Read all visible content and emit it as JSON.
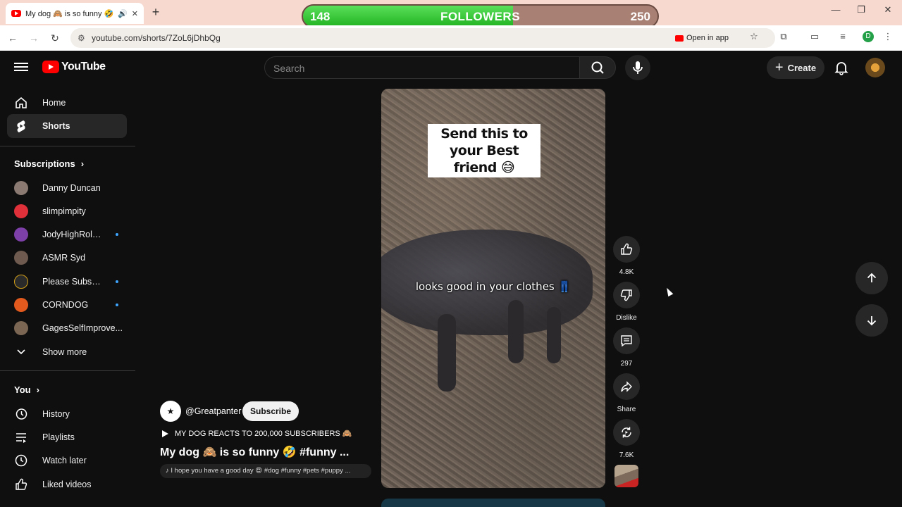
{
  "browser": {
    "tab_title": "My dog 🙈 is so funny 🤣 #funny",
    "url": "youtube.com/shorts/7ZoL6jDhbQg",
    "open_in_app": "Open in app",
    "profile_initial": "D"
  },
  "followers": {
    "current": "148",
    "label": "FOLLOWERS",
    "goal": "250",
    "progress": 0.592
  },
  "header": {
    "logo_text": "YouTube",
    "search_placeholder": "Search",
    "create_label": "Create"
  },
  "sidebar": {
    "nav": [
      {
        "label": "Home",
        "icon": "home-icon"
      },
      {
        "label": "Shorts",
        "icon": "shorts-icon",
        "active": true
      }
    ],
    "subscriptions_label": "Subscriptions",
    "subscriptions": [
      {
        "name": "Danny Duncan",
        "color": "#8a7a72",
        "new": false
      },
      {
        "name": "slimpimpity",
        "color": "#e0303a",
        "new": false
      },
      {
        "name": "JodyHighRoller",
        "color": "#7d3fa8",
        "new": true
      },
      {
        "name": "ASMR Syd",
        "color": "#6e5a4f",
        "new": false
      },
      {
        "name": "Please Subscrib...",
        "color": "#2a2a2a",
        "new": true
      },
      {
        "name": "CORNDOG",
        "color": "#e35a1e",
        "new": true
      },
      {
        "name": "GagesSelfImprove...",
        "color": "#7a6652",
        "new": false
      }
    ],
    "show_more": "Show more",
    "you_label": "You",
    "you_items": [
      {
        "label": "History",
        "icon": "history-icon"
      },
      {
        "label": "Playlists",
        "icon": "playlists-icon"
      },
      {
        "label": "Watch later",
        "icon": "watch-later-icon"
      },
      {
        "label": "Liked videos",
        "icon": "like-icon"
      }
    ]
  },
  "short": {
    "caption_top": "Send this to your Best friend 😅",
    "caption_mid": "looks good in your clothes 👖",
    "channel": "@Greatpanter",
    "channel_avatar_glyph": "★",
    "subscribe_label": "Subscribe",
    "playlist_title": "MY DOG REACTS TO 200,000 SUBSCRIBERS 🙈",
    "title": "My dog 🙈 is so funny 🤣 #funny ...",
    "description": "I hope you have a good day 😍 #dog #funny #pets #puppy ..."
  },
  "actions": {
    "likes": "4.8K",
    "dislike": "Dislike",
    "comments": "297",
    "share": "Share",
    "remix": "7.6K"
  }
}
